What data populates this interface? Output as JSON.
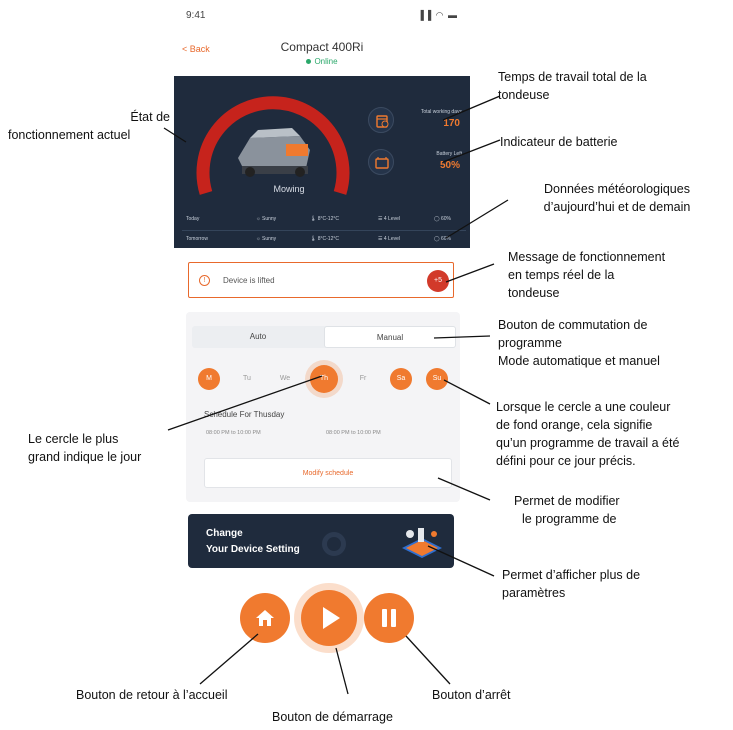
{
  "status_bar": {
    "time": "9:41",
    "icons": "▐▐ ◠ ▬"
  },
  "header": {
    "back_label": "< Back",
    "device_name": "Compact 400Ri",
    "status": "Online"
  },
  "dashboard": {
    "mower_state": "Mowing",
    "working_days_caption": "Total working days",
    "working_days_value": "170",
    "battery_caption": "Battery Left",
    "battery_value": "50%",
    "weather": [
      {
        "day": "Today",
        "condition": "Sunny",
        "temp": "8°C-12°C",
        "wind": "4 Level",
        "humidity": "60%"
      },
      {
        "day": "Tomorrow",
        "condition": "Sunny",
        "temp": "8°C-12°C",
        "wind": "4 Level",
        "humidity": "60%"
      }
    ]
  },
  "alert": {
    "message": "Device is lifted",
    "count": "+5"
  },
  "schedule": {
    "modes": [
      "Auto",
      "Manual"
    ],
    "active_mode": "Manual",
    "days": [
      {
        "label": "M",
        "scheduled": true
      },
      {
        "label": "Tu",
        "scheduled": false
      },
      {
        "label": "We",
        "scheduled": false
      },
      {
        "label": "Th",
        "scheduled": true,
        "selected": true
      },
      {
        "label": "Fr",
        "scheduled": false
      },
      {
        "label": "Sa",
        "scheduled": true
      },
      {
        "label": "Su",
        "scheduled": true
      }
    ],
    "title": "Schedule For Thusday",
    "slots": [
      "08:00 PM to 10:00 PM",
      "08:00 PM to 10:00 PM"
    ],
    "modify_label": "Modify schedule"
  },
  "banner": {
    "line1": "Change",
    "line2": "Your Device Setting"
  },
  "controls": {
    "home_icon": "home-icon",
    "play_icon": "play-icon",
    "pause_icon": "pause-icon"
  },
  "annotations": {
    "working_time": [
      "Temps de travail total de la",
      "tondeuse"
    ],
    "state": [
      "État de",
      "fonctionnement actuel"
    ],
    "battery": [
      "Indicateur de batterie"
    ],
    "weather": [
      "Données météorologiques",
      "d’aujourd’hui et de demain"
    ],
    "message": [
      "Message de fonctionnement",
      "en temps réel de la",
      "tondeuse"
    ],
    "mode_switch": [
      "Bouton de commutation de",
      "programme",
      "Mode automatique et manuel"
    ],
    "orange_circle": [
      "Lorsque le cercle a une couleur",
      "de fond orange, cela signifie",
      "qu’un programme de travail a été",
      "défini pour ce jour précis."
    ],
    "big_circle": [
      "Le cercle le plus",
      "grand indique le jour"
    ],
    "modify": [
      "Permet de modifier",
      "le programme de"
    ],
    "more_settings": [
      "Permet d’afficher plus de",
      "paramètres"
    ],
    "home_btn": [
      "Bouton de retour à l’accueil"
    ],
    "start_btn": [
      "Bouton de démarrage"
    ],
    "stop_btn": [
      "Bouton d’arrêt"
    ]
  },
  "colors": {
    "accent": "#f07a2f",
    "dark_panel": "#1f2b3d",
    "online": "#2aa86a",
    "alert_badge": "#d23a2a"
  }
}
